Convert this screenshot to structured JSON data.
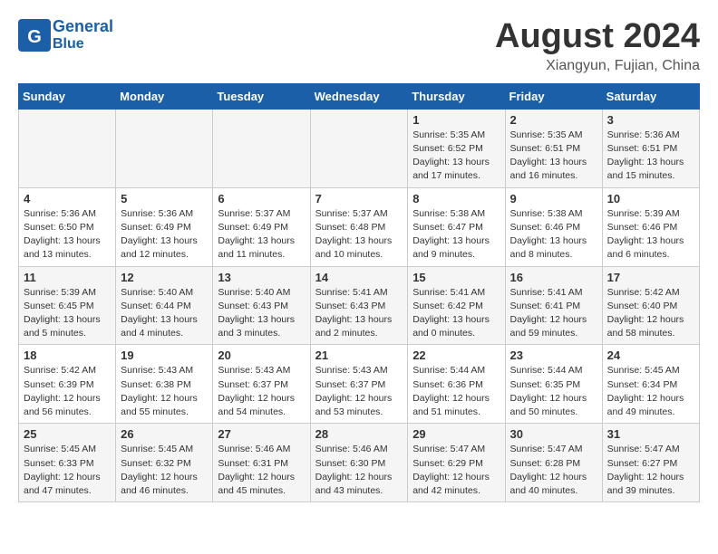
{
  "header": {
    "logo_general": "General",
    "logo_blue": "Blue",
    "month": "August 2024",
    "location": "Xiangyun, Fujian, China"
  },
  "weekdays": [
    "Sunday",
    "Monday",
    "Tuesday",
    "Wednesday",
    "Thursday",
    "Friday",
    "Saturday"
  ],
  "weeks": [
    [
      {
        "day": "",
        "info": ""
      },
      {
        "day": "",
        "info": ""
      },
      {
        "day": "",
        "info": ""
      },
      {
        "day": "",
        "info": ""
      },
      {
        "day": "1",
        "info": "Sunrise: 5:35 AM\nSunset: 6:52 PM\nDaylight: 13 hours\nand 17 minutes."
      },
      {
        "day": "2",
        "info": "Sunrise: 5:35 AM\nSunset: 6:51 PM\nDaylight: 13 hours\nand 16 minutes."
      },
      {
        "day": "3",
        "info": "Sunrise: 5:36 AM\nSunset: 6:51 PM\nDaylight: 13 hours\nand 15 minutes."
      }
    ],
    [
      {
        "day": "4",
        "info": "Sunrise: 5:36 AM\nSunset: 6:50 PM\nDaylight: 13 hours\nand 13 minutes."
      },
      {
        "day": "5",
        "info": "Sunrise: 5:36 AM\nSunset: 6:49 PM\nDaylight: 13 hours\nand 12 minutes."
      },
      {
        "day": "6",
        "info": "Sunrise: 5:37 AM\nSunset: 6:49 PM\nDaylight: 13 hours\nand 11 minutes."
      },
      {
        "day": "7",
        "info": "Sunrise: 5:37 AM\nSunset: 6:48 PM\nDaylight: 13 hours\nand 10 minutes."
      },
      {
        "day": "8",
        "info": "Sunrise: 5:38 AM\nSunset: 6:47 PM\nDaylight: 13 hours\nand 9 minutes."
      },
      {
        "day": "9",
        "info": "Sunrise: 5:38 AM\nSunset: 6:46 PM\nDaylight: 13 hours\nand 8 minutes."
      },
      {
        "day": "10",
        "info": "Sunrise: 5:39 AM\nSunset: 6:46 PM\nDaylight: 13 hours\nand 6 minutes."
      }
    ],
    [
      {
        "day": "11",
        "info": "Sunrise: 5:39 AM\nSunset: 6:45 PM\nDaylight: 13 hours\nand 5 minutes."
      },
      {
        "day": "12",
        "info": "Sunrise: 5:40 AM\nSunset: 6:44 PM\nDaylight: 13 hours\nand 4 minutes."
      },
      {
        "day": "13",
        "info": "Sunrise: 5:40 AM\nSunset: 6:43 PM\nDaylight: 13 hours\nand 3 minutes."
      },
      {
        "day": "14",
        "info": "Sunrise: 5:41 AM\nSunset: 6:43 PM\nDaylight: 13 hours\nand 2 minutes."
      },
      {
        "day": "15",
        "info": "Sunrise: 5:41 AM\nSunset: 6:42 PM\nDaylight: 13 hours\nand 0 minutes."
      },
      {
        "day": "16",
        "info": "Sunrise: 5:41 AM\nSunset: 6:41 PM\nDaylight: 12 hours\nand 59 minutes."
      },
      {
        "day": "17",
        "info": "Sunrise: 5:42 AM\nSunset: 6:40 PM\nDaylight: 12 hours\nand 58 minutes."
      }
    ],
    [
      {
        "day": "18",
        "info": "Sunrise: 5:42 AM\nSunset: 6:39 PM\nDaylight: 12 hours\nand 56 minutes."
      },
      {
        "day": "19",
        "info": "Sunrise: 5:43 AM\nSunset: 6:38 PM\nDaylight: 12 hours\nand 55 minutes."
      },
      {
        "day": "20",
        "info": "Sunrise: 5:43 AM\nSunset: 6:37 PM\nDaylight: 12 hours\nand 54 minutes."
      },
      {
        "day": "21",
        "info": "Sunrise: 5:43 AM\nSunset: 6:37 PM\nDaylight: 12 hours\nand 53 minutes."
      },
      {
        "day": "22",
        "info": "Sunrise: 5:44 AM\nSunset: 6:36 PM\nDaylight: 12 hours\nand 51 minutes."
      },
      {
        "day": "23",
        "info": "Sunrise: 5:44 AM\nSunset: 6:35 PM\nDaylight: 12 hours\nand 50 minutes."
      },
      {
        "day": "24",
        "info": "Sunrise: 5:45 AM\nSunset: 6:34 PM\nDaylight: 12 hours\nand 49 minutes."
      }
    ],
    [
      {
        "day": "25",
        "info": "Sunrise: 5:45 AM\nSunset: 6:33 PM\nDaylight: 12 hours\nand 47 minutes."
      },
      {
        "day": "26",
        "info": "Sunrise: 5:45 AM\nSunset: 6:32 PM\nDaylight: 12 hours\nand 46 minutes."
      },
      {
        "day": "27",
        "info": "Sunrise: 5:46 AM\nSunset: 6:31 PM\nDaylight: 12 hours\nand 45 minutes."
      },
      {
        "day": "28",
        "info": "Sunrise: 5:46 AM\nSunset: 6:30 PM\nDaylight: 12 hours\nand 43 minutes."
      },
      {
        "day": "29",
        "info": "Sunrise: 5:47 AM\nSunset: 6:29 PM\nDaylight: 12 hours\nand 42 minutes."
      },
      {
        "day": "30",
        "info": "Sunrise: 5:47 AM\nSunset: 6:28 PM\nDaylight: 12 hours\nand 40 minutes."
      },
      {
        "day": "31",
        "info": "Sunrise: 5:47 AM\nSunset: 6:27 PM\nDaylight: 12 hours\nand 39 minutes."
      }
    ]
  ]
}
